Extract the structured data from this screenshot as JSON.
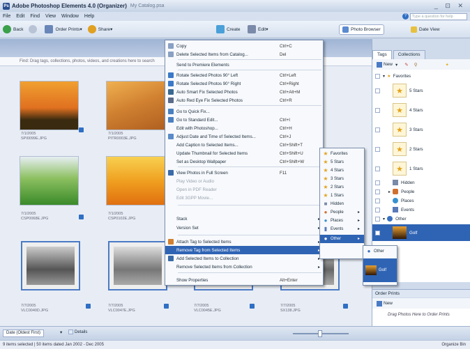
{
  "window": {
    "title": "Adobe Photoshop Elements 4.0 (Organizer)",
    "catalog": "My Catalog.psa",
    "controls": "_ ⊡ ✕"
  },
  "menubar": [
    "File",
    "Edit",
    "Find",
    "View",
    "Window",
    "Help"
  ],
  "help": {
    "placeholder": "Type a question for help"
  },
  "toolbar": {
    "back": "Back",
    "order_prints": "Order Prints",
    "share": "Share",
    "create": "Create",
    "edit": "Edit",
    "photo_browser": "Photo Browser",
    "date_view": "Date View"
  },
  "find_bar": "Find: Drag tags, collections, photos, videos, and creations here to search",
  "photos": [
    {
      "date": "7/1/2005",
      "file": "SPI0099E.JPG"
    },
    {
      "date": "7/1/2005",
      "file": "PITR0003E.JPG"
    },
    {
      "date": "7/1/2005",
      "file": "CSP0068E.JPG"
    },
    {
      "date": "7/1/2005",
      "file": "CSP0102E.JPG"
    },
    {
      "date": "7/7/2005",
      "file": "VLC0040D.JPG"
    },
    {
      "date": "7/7/2005",
      "file": "VLC0047E.JPG"
    },
    {
      "date": "7/7/2005",
      "file": "VLC0045E.JPG"
    },
    {
      "date": "7/7/2005",
      "file": "SX138.JPG"
    }
  ],
  "context_menu": [
    {
      "label": "Copy",
      "shortcut": "Ctrl+C"
    },
    {
      "label": "Delete Selected Items from Catalog...",
      "shortcut": "Del"
    },
    {
      "label": "Send to Premiere Elements",
      "shortcut": ""
    },
    {
      "label": "Rotate Selected Photos 90° Left",
      "shortcut": "Ctrl+Left"
    },
    {
      "label": "Rotate Selected Photos 90° Right",
      "shortcut": "Ctrl+Right"
    },
    {
      "label": "Auto Smart Fix Selected Photos",
      "shortcut": "Ctrl+Alt+M"
    },
    {
      "label": "Auto Red Eye Fix Selected Photos",
      "shortcut": "Ctrl+R"
    },
    {
      "label": "Go to Quick Fix...",
      "shortcut": ""
    },
    {
      "label": "Go to Standard Edit...",
      "shortcut": "Ctrl+I"
    },
    {
      "label": "Edit with Photoshop...",
      "shortcut": "Ctrl+H"
    },
    {
      "label": "Adjust Date and Time of Selected Items...",
      "shortcut": "Ctrl+J"
    },
    {
      "label": "Add Caption to Selected Items...",
      "shortcut": "Ctrl+Shift+T"
    },
    {
      "label": "Update Thumbnail for Selected Items",
      "shortcut": "Ctrl+Shift+U"
    },
    {
      "label": "Set as Desktop Wallpaper",
      "shortcut": "Ctrl+Shift+W"
    },
    {
      "label": "View Photos in Full Screen",
      "shortcut": "F11"
    },
    {
      "label": "Play Video or Audio",
      "shortcut": ""
    },
    {
      "label": "Open in PDF Reader",
      "shortcut": ""
    },
    {
      "label": "Edit 3GPP Movie...",
      "shortcut": ""
    },
    {
      "label": "Stack",
      "shortcut": ""
    },
    {
      "label": "Version Set",
      "shortcut": ""
    },
    {
      "label": "Attach Tag to Selected Items",
      "shortcut": ""
    },
    {
      "label": "Remove Tag from Selected Items",
      "shortcut": ""
    },
    {
      "label": "Add Selected Items to Collection",
      "shortcut": ""
    },
    {
      "label": "Remove Selected Items from Collection",
      "shortcut": ""
    },
    {
      "label": "Show Properties",
      "shortcut": "Alt+Enter"
    }
  ],
  "submenu": [
    "Favorites",
    "5 Stars",
    "4 Stars",
    "3 Stars",
    "2 Stars",
    "1 Stars",
    "Hidden",
    "People",
    "Places",
    "Events",
    "Other"
  ],
  "submenu2": [
    "Other",
    "Golf"
  ],
  "panel": {
    "tabs": [
      "Tags",
      "Collections"
    ],
    "new_label": "New",
    "tags": [
      "Favorites",
      "5 Stars",
      "4 Stars",
      "3 Stars",
      "2 Stars",
      "1 Stars",
      "Hidden",
      "People",
      "Places",
      "Events",
      "Other",
      "Golf"
    ],
    "order_prints": "Order Prints",
    "order_new": "New",
    "order_hint": "Drag Photos Here to Order Prints"
  },
  "bottombar": {
    "sort": "Date (Oldest First)",
    "details": "Details"
  },
  "status": {
    "text": "9 items selected  |  50 items dated Jan 2002 - Dec 2005",
    "organize_bin": "Organize Bin"
  }
}
